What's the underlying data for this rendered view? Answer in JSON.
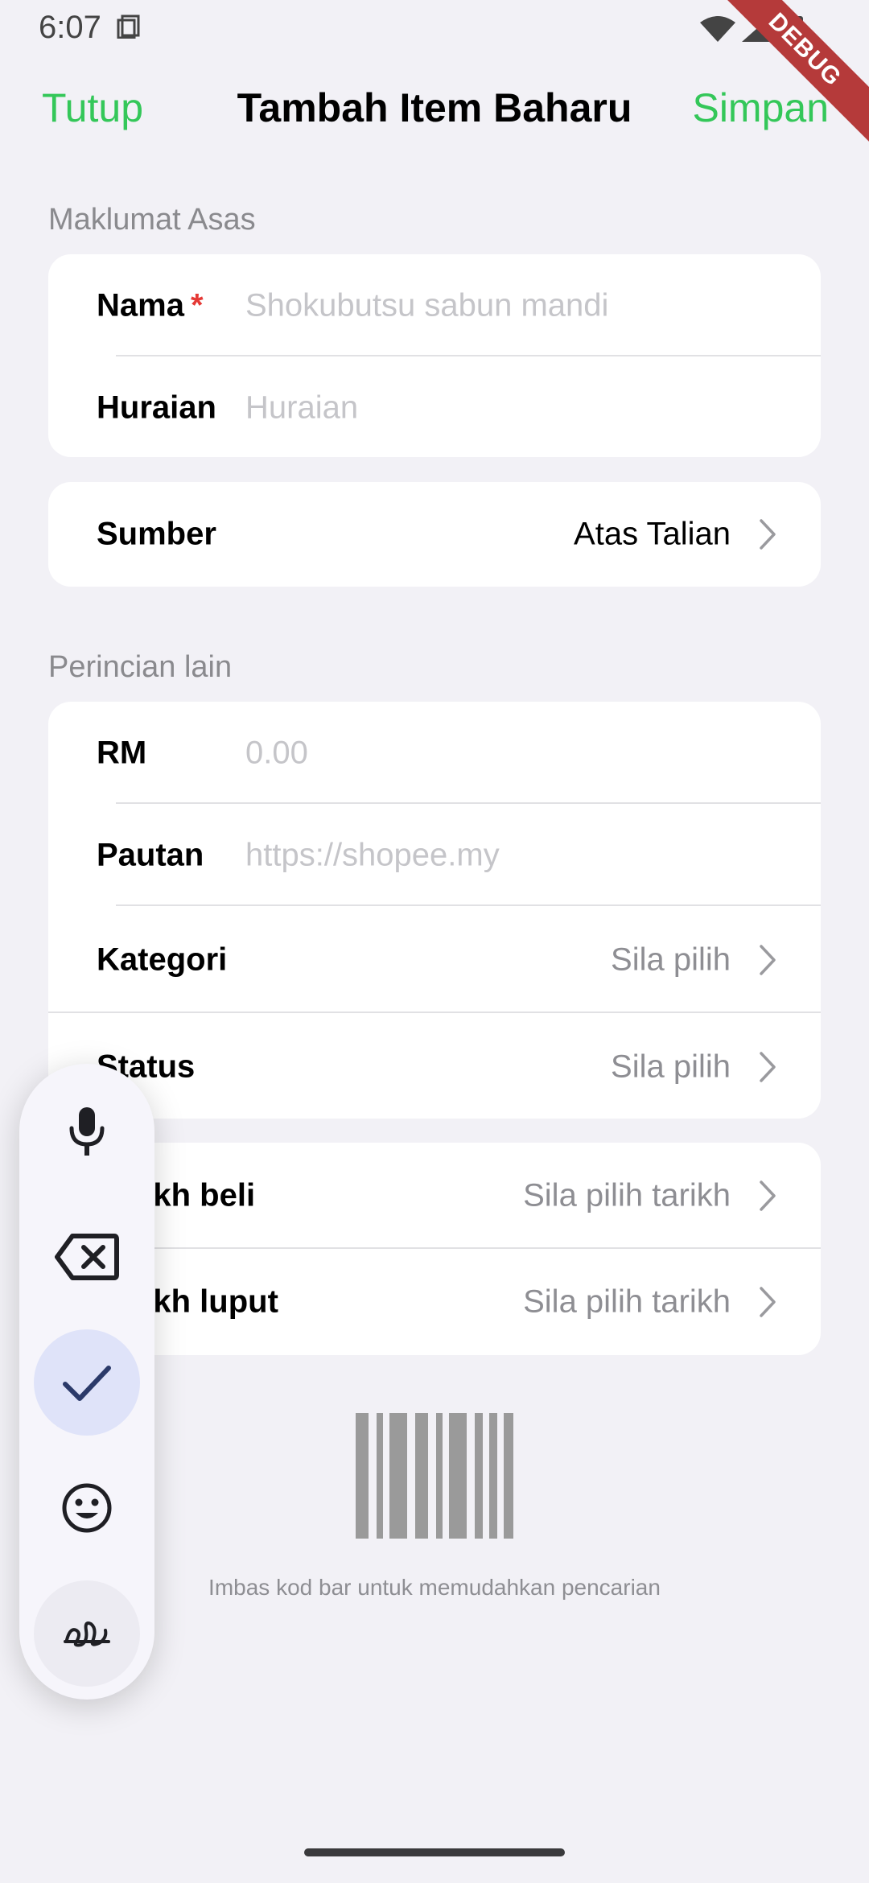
{
  "status_bar": {
    "time": "6:07",
    "debug_label": "DEBUG"
  },
  "nav": {
    "close_label": "Tutup",
    "title": "Tambah Item Baharu",
    "save_label": "Simpan"
  },
  "basic_info": {
    "section_label": "Maklumat Asas",
    "name_label": "Nama",
    "required_mark": "*",
    "name_placeholder": "Shokubutsu sabun mandi",
    "description_label": "Huraian",
    "description_placeholder": "Huraian"
  },
  "source": {
    "label": "Sumber",
    "value": "Atas Talian"
  },
  "other_details": {
    "section_label": "Perincian lain",
    "price_label": "RM",
    "price_placeholder": "0.00",
    "link_label": "Pautan",
    "link_placeholder": "https://shopee.my",
    "category_label": "Kategori",
    "category_value": "Sila pilih",
    "status_label": "Status",
    "status_value": "Sila pilih"
  },
  "dates": {
    "purchase_label": "Tarikh beli",
    "purchase_value": "Sila pilih tarikh",
    "expiry_label": "Tarikh luput",
    "expiry_value": "Sila pilih tarikh"
  },
  "barcode": {
    "hint": "Imbas kod bar untuk memudahkan pencarian"
  },
  "floating_toolbar": {
    "icons": [
      "microphone-icon",
      "backspace-icon",
      "check-icon",
      "emoji-icon",
      "handwriting-icon"
    ]
  },
  "colors": {
    "accent": "#34c759",
    "required": "#e53935",
    "background": "#f2f1f6",
    "toolbar_selected": "#dfe3f9"
  }
}
